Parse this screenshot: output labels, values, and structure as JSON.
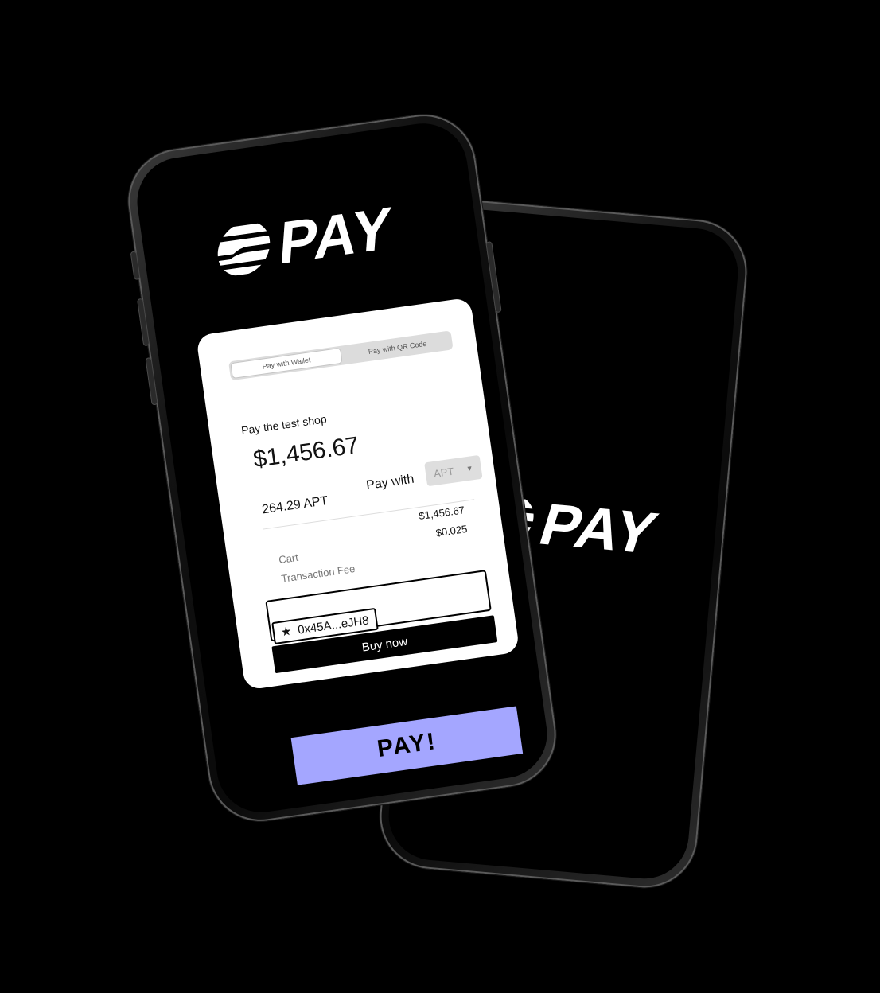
{
  "brand": {
    "logo_text": "PAY"
  },
  "checkout": {
    "tabs": [
      "Pay with Wallet",
      "Pay with QR Code"
    ],
    "shop_title": "Pay the test shop",
    "amount": "$1,456.67",
    "crypto_amount": "264.29 APT",
    "pay_with_label": "Pay with",
    "currency_selected": "APT",
    "rows": [
      {
        "label": "Cart",
        "value": "$1,456.67"
      },
      {
        "label": "Transaction Fee",
        "value": "$0.025"
      }
    ],
    "wallet_address": "0x45A...eJH8",
    "buy_label": "Buy now"
  },
  "pay_button": {
    "label": "PAY!"
  },
  "colors": {
    "pay_button": "#a4a6ff",
    "background": "#000000"
  },
  "icons": {
    "logo_mark": "pay-logo-icon",
    "wallet": "star-icon",
    "select": "caret-down-icon"
  }
}
